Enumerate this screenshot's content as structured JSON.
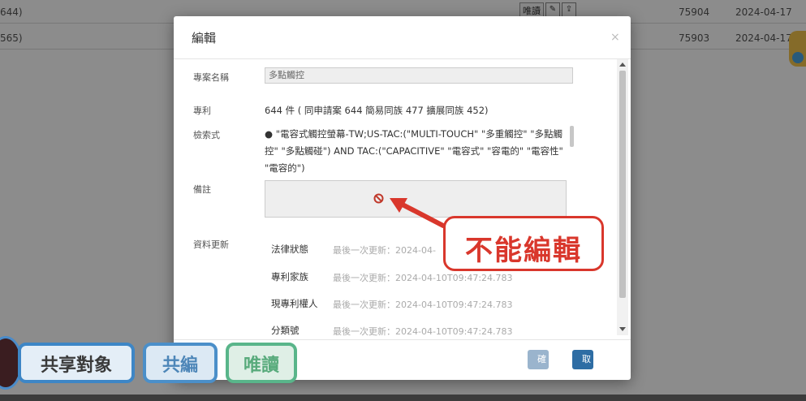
{
  "background_table": {
    "rows": [
      {
        "id_fragment": "644)",
        "read_label": "唯讀",
        "number": "75904",
        "date": "2024-04-17"
      },
      {
        "id_fragment": "565)",
        "read_label": "",
        "number": "75903",
        "date": "2024-04-17"
      }
    ]
  },
  "modal": {
    "title": "編輯",
    "close_label": "×",
    "fields": {
      "project_name_label": "專案名稱",
      "project_name_value": "多點觸控",
      "patent_label": "專利",
      "patent_value": "644 件 ( 同申請案 644 簡易同族 477 擴展同族 452)",
      "search_label": "檢索式",
      "search_value": "● \"電容式觸控螢幕-TW;US-TAC:(\"MULTI-TOUCH\" \"多重觸控\" \"多點觸控\" \"多點觸碰\") AND TAC:(\"CAPACITIVE\" \"電容式\" \"容電的\" \"電容性\" \"電容的\")",
      "notes_label": "備註",
      "data_update_label": "資料更新"
    },
    "updates": [
      {
        "name": "法律狀態",
        "meta": "最後一次更新：2024-04-"
      },
      {
        "name": "專利家族",
        "meta": "最後一次更新：2024-04-10T09:47:24.783"
      },
      {
        "name": "現專利權人",
        "meta": "最後一次更新：2024-04-10T09:47:24.783"
      },
      {
        "name": "分類號",
        "meta": "最後一次更新：2024-04-10T09:47:24.783"
      }
    ],
    "buttons": {
      "confirm": "確定",
      "cancel": "取消"
    }
  },
  "callout": {
    "text": "不能編輯",
    "color": "#d9372c"
  },
  "chips": {
    "share_target": "共享對象",
    "co_edit": "共編",
    "read_only": "唯讀"
  },
  "colors": {
    "cancel_button": "#2e6da4",
    "confirm_button": "#9ab4cd",
    "chip_blue": "#3d86c6",
    "chip_green": "#59b58a"
  }
}
